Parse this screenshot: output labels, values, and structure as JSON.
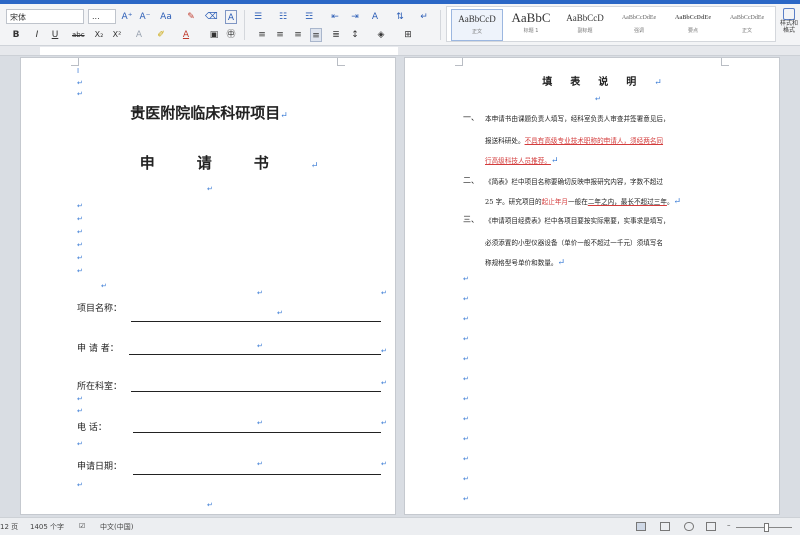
{
  "toolbar": {
    "font_name": "宋体",
    "font_size": "...",
    "styles": [
      {
        "preview": "AaBbCcD",
        "name": "正文",
        "size": "normal",
        "active": true
      },
      {
        "preview": "AaBbC",
        "name": "标题 1",
        "size": "big",
        "active": false
      },
      {
        "preview": "AaBbCcD",
        "name": "副标题",
        "size": "normal",
        "active": false
      },
      {
        "preview": "AaBbCcDdEe",
        "name": "强调",
        "size": "tiny",
        "active": false
      },
      {
        "preview": "AaBbCcDdEe",
        "name": "要点",
        "size": "tiny",
        "active": false
      },
      {
        "preview": "AaBbCcDdEe",
        "name": "正文",
        "size": "tiny",
        "active": false
      }
    ],
    "style_pane_label": "样式和格式"
  },
  "left_page": {
    "title": "贵医附院临床科研项目",
    "subtitle": "申请书",
    "fields": [
      {
        "label": "项目名称："
      },
      {
        "label": "申 请 者："
      },
      {
        "label": "所在科室："
      },
      {
        "label": "电    话："
      },
      {
        "label": "申请日期："
      }
    ]
  },
  "right_page": {
    "title": "填表说明",
    "items": [
      {
        "num": "一、",
        "lines": [
          [
            {
              "t": "本申请书由课题负责人填写，经科室负责人审查并签署意见后，"
            }
          ],
          [
            {
              "t": "报送科研处。"
            },
            {
              "t": "不具有高级专业技术职称的申请人，须经两名同",
              "hl": true,
              "ul": true
            }
          ],
          [
            {
              "t": "行高级科技人员推荐。",
              "hl": true,
              "ul": true
            }
          ]
        ]
      },
      {
        "num": "二、",
        "lines": [
          [
            {
              "t": "《简表》栏中项目名称要确切反映申报研究内容，字数不超过"
            }
          ],
          [
            {
              "t": "25 字。研究项目的"
            },
            {
              "t": "起止年月",
              "hl": true
            },
            {
              "t": "一般在"
            },
            {
              "t": "二年之内，最长不超过三年",
              "ul": true
            },
            {
              "t": "。"
            }
          ]
        ]
      },
      {
        "num": "三、",
        "lines": [
          [
            {
              "t": "《申请项目经费表》栏中各项目要按实际需要，实事求是填写，"
            }
          ],
          [
            {
              "t": "必须添置的小型仪器设备（单价一般不超过一千元）须填写名"
            }
          ],
          [
            {
              "t": "称规格型号单价和数量。"
            }
          ]
        ]
      }
    ]
  },
  "status": {
    "page": "12 页",
    "words": "1405 个字",
    "language": "中文(中国)"
  }
}
